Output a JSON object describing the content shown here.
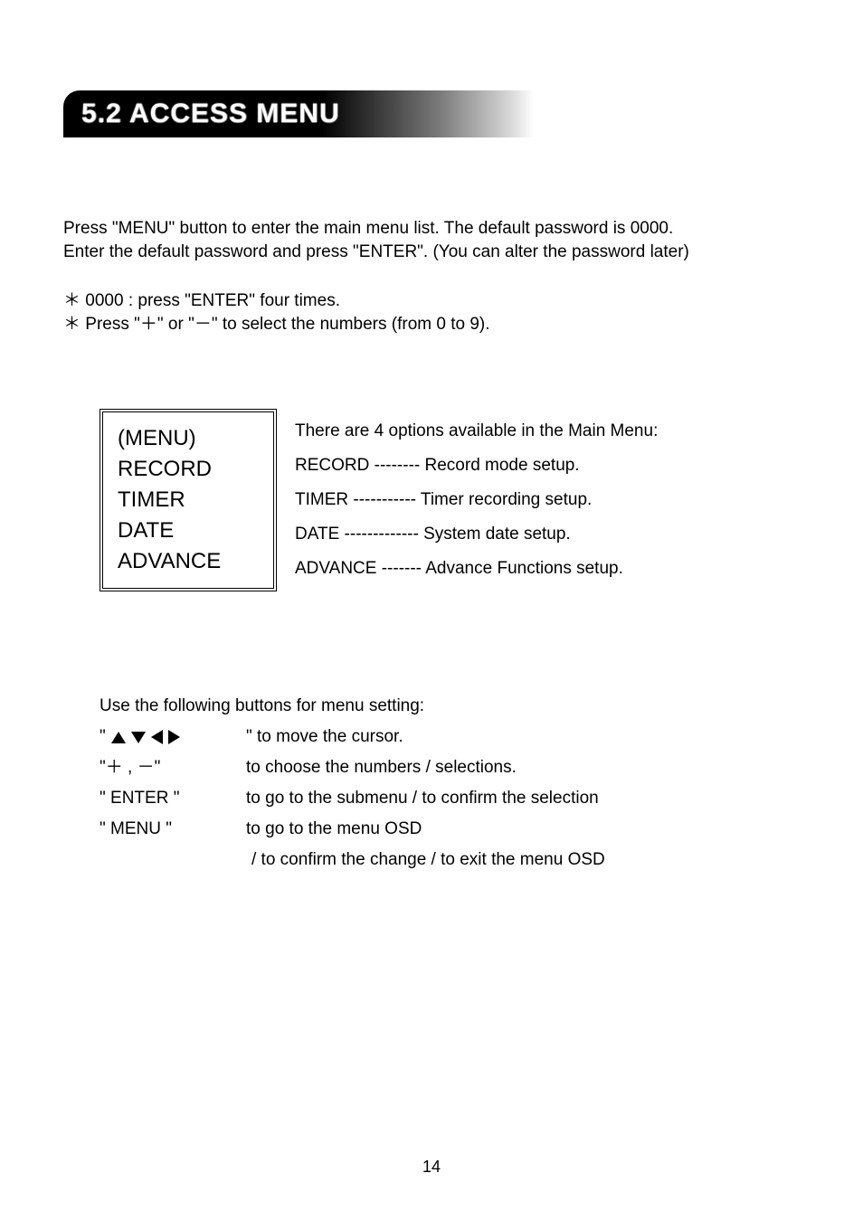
{
  "heading": "5.2 ACCESS MENU",
  "intro": {
    "line1": "Press \"MENU\" button to enter the main menu list. The default password is 0000.",
    "line2": "Enter the default password and press \"ENTER\". (You can alter the password later)"
  },
  "notes": {
    "n1": "0000 : press \"ENTER\" four times.",
    "n2": "Press \"＋\" or \"－\" to select the numbers (from 0 to 9)."
  },
  "menu_box": {
    "title": "(MENU)",
    "items": [
      "RECORD",
      "TIMER",
      "DATE",
      "ADVANCE"
    ]
  },
  "menu_desc": {
    "intro": "There are 4 options available in the Main Menu:",
    "lines": [
      "RECORD -------- Record mode setup.",
      "TIMER  ----------- Timer recording setup.",
      "DATE ------------- System date setup.",
      "ADVANCE ------- Advance Functions setup."
    ]
  },
  "legend": {
    "intro": "Use the following buttons for menu setting:",
    "arrows_val": "\" to move the cursor.",
    "plusminus_key": "\"＋ , －\"",
    "plusminus_val": "to choose the numbers / selections.",
    "enter_key": "\" ENTER \"",
    "enter_val": "to go to the submenu / to confirm the selection",
    "menu_key": "\" MENU \"",
    "menu_val1": "to go to the menu OSD",
    "menu_val2": "/ to confirm the change / to exit the menu OSD"
  },
  "page_number": "14"
}
